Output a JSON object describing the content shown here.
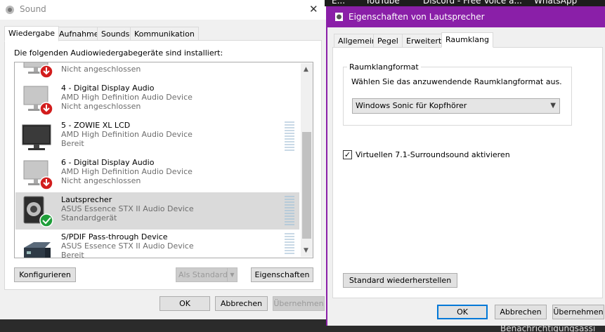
{
  "sound_window": {
    "title": "Sound",
    "close_glyph": "✕",
    "tabs": [
      "Wiedergabe",
      "Aufnahme",
      "Sounds",
      "Kommunikation"
    ],
    "heading": "Die folgenden Audiowiedergabegeräte sind installiert:",
    "devices": [
      {
        "name": "",
        "desc": "",
        "status": "Nicht angeschlossen",
        "icon": "monitor-disconnected-icon"
      },
      {
        "name": "4 - Digital Display Audio",
        "desc": "AMD High Definition Audio Device",
        "status": "Nicht angeschlossen",
        "icon": "monitor-disconnected-icon"
      },
      {
        "name": "5 - ZOWIE XL LCD",
        "desc": "AMD High Definition Audio Device",
        "status": "Bereit",
        "icon": "monitor-icon"
      },
      {
        "name": "6 - Digital Display Audio",
        "desc": "AMD High Definition Audio Device",
        "status": "Nicht angeschlossen",
        "icon": "monitor-disconnected-icon"
      },
      {
        "name": "Lautsprecher",
        "desc": "ASUS Essence STX II Audio Device",
        "status": "Standardgerät",
        "icon": "speaker-default-icon"
      },
      {
        "name": "S/PDIF Pass-through Device",
        "desc": "ASUS Essence STX II Audio Device",
        "status": "Bereit",
        "icon": "spdif-device-icon"
      }
    ],
    "buttons": {
      "configure": "Konfigurieren",
      "set_default": "Als Standard",
      "properties": "Eigenschaften",
      "ok": "OK",
      "cancel": "Abbrechen",
      "apply": "Übernehmen"
    }
  },
  "properties_window": {
    "title": "Eigenschaften von Lautsprecher",
    "tabs": [
      "Allgemein",
      "Pegel",
      "Erweitert",
      "Raumklang"
    ],
    "group_label": "Raumklangformat",
    "group_desc": "Wählen Sie das anzuwendende Raumklangformat aus.",
    "format_value": "Windows Sonic für Kopfhörer",
    "surround_checked": true,
    "surround_label": "Virtuellen 7.1-Surroundsound aktivieren",
    "buttons": {
      "restore": "Standard wiederherstellen",
      "ok": "OK",
      "cancel": "Abbrechen",
      "apply": "Übernehmen"
    }
  },
  "taskbar": {
    "items": [
      "E...",
      "YouTube",
      "Discord - Free Voice a...",
      "WhatsApp"
    ],
    "notification": "Benachrichtigungsassi"
  },
  "colors": {
    "accent": "#8a1fa8",
    "default_check": "#1f9e3a",
    "disconnected": "#d21d1d"
  }
}
